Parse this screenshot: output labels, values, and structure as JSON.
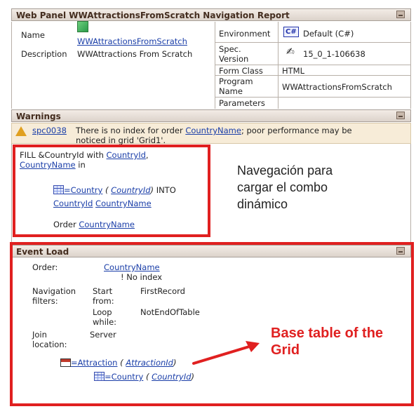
{
  "report": {
    "title": "Web Panel WWAttractionsFromScratch Navigation Report",
    "name_label": "Name",
    "name_value": "WWAttractionsFromScratch",
    "description_label": "Description",
    "description_value": "WWAttractions From Scratch",
    "environment_label": "Environment",
    "environment_badge": "C#",
    "environment_value": "Default (C#)",
    "spec_label_1": "Spec.",
    "spec_label_2": "Version",
    "spec_value": "15_0_1-106638",
    "form_class_label": "Form Class",
    "form_class_value": "HTML",
    "program_label_1": "Program",
    "program_label_2": "Name",
    "program_value": "WWAttractionsFromScratch",
    "parameters_label": "Parameters"
  },
  "warnings": {
    "title": "Warnings",
    "code": "spc0038",
    "text_before": "There is no index for order",
    "text_link": "CountryName",
    "text_after": "; poor performance may be",
    "text_line2": "noticed in grid 'Grid1'."
  },
  "fill": {
    "line1_prefix": "FILL &CountryId with",
    "line1_link": "CountryId",
    "line1_suffix": ",",
    "line2_link": "CountryName",
    "line2_suffix": "in",
    "table_link": "=Country",
    "table_key_open": "(",
    "table_key": "CountryId",
    "table_key_close": ")",
    "into": "INTO",
    "into_field1": "CountryId",
    "into_field2": "CountryName",
    "order_label": "Order",
    "order_value": "CountryName"
  },
  "annotations": {
    "nav_note_line1": "Navegación para",
    "nav_note_line2": "cargar el combo",
    "nav_note_line3": "dinámico",
    "base_note_line1": "Base table of the",
    "base_note_line2": "Grid"
  },
  "event_load": {
    "title": "Event Load",
    "order_label": "Order:",
    "order_value": "CountryName",
    "no_index": "! No index",
    "nav_filters_label_1": "Navigation",
    "nav_filters_label_2": "filters:",
    "start_label_1": "Start",
    "start_label_2": "from:",
    "start_value": "FirstRecord",
    "loop_label_1": "Loop",
    "loop_label_2": "while:",
    "loop_value": "NotEndOfTable",
    "join_label_1": "Join",
    "join_label_2": "location:",
    "join_value": "Server",
    "base_table_link": "=Attraction",
    "base_key_open": "(",
    "base_key": "AttractionId",
    "base_key_close": ")",
    "sub_table_link": "=Country",
    "sub_key_open": "(",
    "sub_key": "CountryId",
    "sub_key_close": ")"
  },
  "colors": {
    "annotation_red": "#e02020",
    "link_blue": "#1a3ea8",
    "header_text": "#442d1f"
  }
}
